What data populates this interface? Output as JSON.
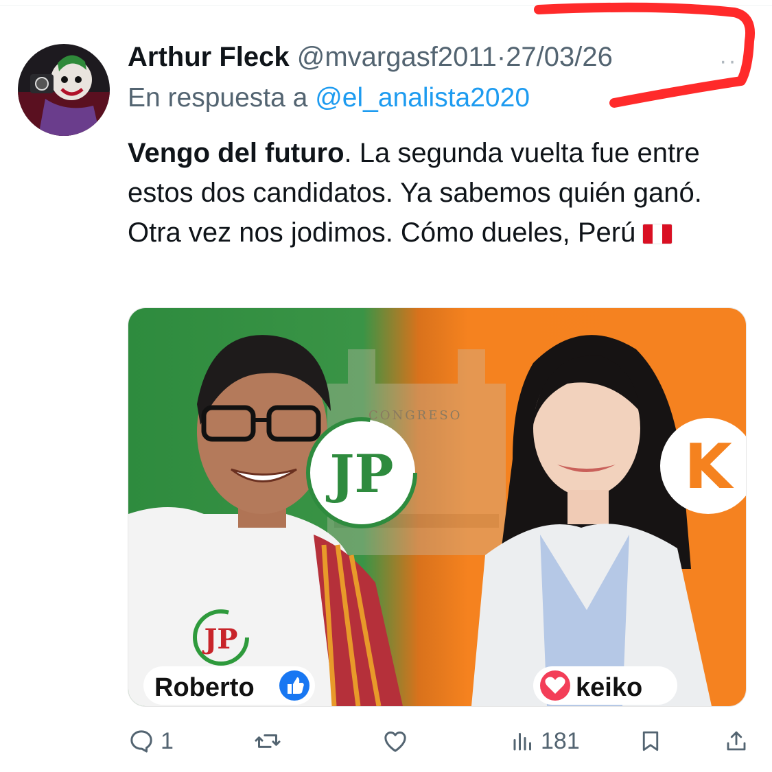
{
  "tweet": {
    "author_name": "Arthur Fleck",
    "handle": "@mvargasf2011",
    "separator": "·",
    "date": "27/03/26",
    "more_label": "··",
    "reply_label": "En respuesta a",
    "reply_to": "@el_analista2020",
    "text_bold": "Vengo del futuro",
    "text_rest": ". La segunda vuelta fue entre estos dos candidatos. Ya sabemos quién ganó. Otra vez nos jodimos. Cómo dueles, Perú",
    "flag": "flag-peru-icon"
  },
  "media": {
    "left_bg_color": "#2e8b3e",
    "right_bg_color": "#f5821f",
    "building_sign": "CONGRESO",
    "left_party_logo": "JP",
    "right_party_logo": "K",
    "left_badge_logo": "JP",
    "left_name": "Roberto",
    "left_name_icon": "thumbs-up-icon",
    "right_name": "keiko",
    "right_name_icon": "heart-icon"
  },
  "actions": {
    "reply_count": "1",
    "retweet_count": "",
    "like_count": "",
    "views_count": "181"
  },
  "colors": {
    "link": "#1d9bf0",
    "muted": "#536471",
    "annotation": "#ff2a2a"
  }
}
